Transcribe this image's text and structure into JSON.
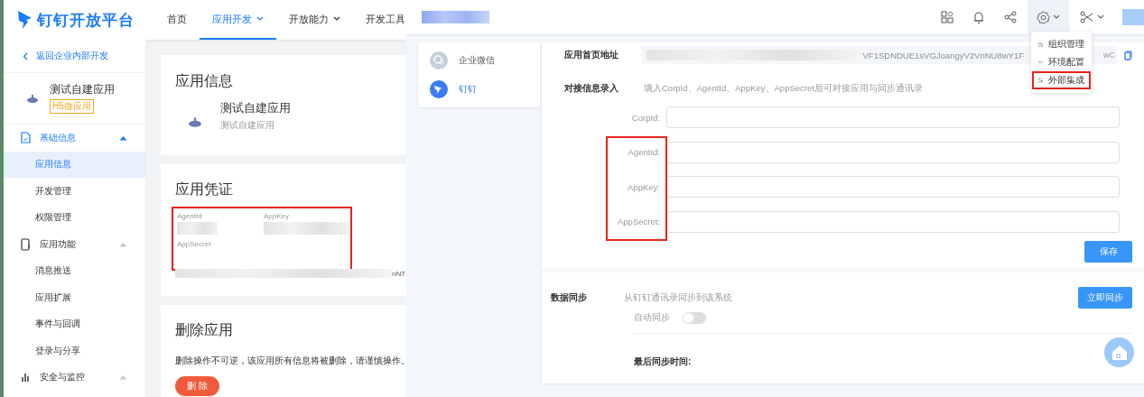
{
  "left_window": {
    "logo": "钉钉开放平台",
    "nav": [
      {
        "label": "首页",
        "selected": false,
        "dropdown": false
      },
      {
        "label": "应用开发",
        "selected": true,
        "dropdown": true
      },
      {
        "label": "开放能力",
        "selected": false,
        "dropdown": true
      },
      {
        "label": "开发工具",
        "selected": false,
        "dropdown": false
      }
    ],
    "sidebar": {
      "back_link": "返回企业内部开发",
      "app": {
        "name": "测试自建应用",
        "badge": "H5微应用"
      },
      "groups": [
        {
          "label": "基础信息",
          "kind": "document",
          "expanded": true,
          "active": true,
          "children": [
            {
              "label": "应用信息",
              "selected": true
            },
            {
              "label": "开发管理",
              "selected": false
            },
            {
              "label": "权限管理",
              "selected": false
            }
          ]
        },
        {
          "label": "应用功能",
          "kind": "phone",
          "expanded": true,
          "active": false,
          "children": [
            {
              "label": "消息推送",
              "selected": false
            },
            {
              "label": "应用扩展",
              "selected": false
            },
            {
              "label": "事件与回调",
              "selected": false
            },
            {
              "label": "登录与分享",
              "selected": false
            }
          ]
        },
        {
          "label": "安全与监控",
          "kind": "chart",
          "expanded": true,
          "active": false
        }
      ]
    },
    "app_info": {
      "title": "应用信息",
      "name": "测试自建应用",
      "description": "测试自建应用"
    },
    "credentials": {
      "title": "应用凭证",
      "highlighted": true,
      "fields": [
        {
          "label": "AgentId"
        },
        {
          "label": "AppKey"
        }
      ],
      "secret": {
        "label": "AppSecret",
        "visible_tail": "nNT"
      }
    },
    "delete": {
      "title": "删除应用",
      "warning": "删除操作不可逆，该应用所有信息将被删除，请谨慎操作。",
      "button": "删 除"
    }
  },
  "right_window": {
    "header_icons": [
      {
        "kind": "apps",
        "dropdown": false,
        "open": false
      },
      {
        "kind": "bell",
        "dropdown": false,
        "open": false
      },
      {
        "kind": "share",
        "dropdown": false,
        "open": false
      },
      {
        "kind": "gear",
        "dropdown": true,
        "open": true
      },
      {
        "kind": "tools",
        "dropdown": true,
        "open": false
      }
    ],
    "settings_menu": [
      {
        "label": "组织管理",
        "kind": "building",
        "highlighted": false
      },
      {
        "label": "环境配置",
        "kind": "env",
        "highlighted": false
      },
      {
        "label": "外部集成",
        "kind": "integration",
        "highlighted": true
      }
    ],
    "platforms": [
      {
        "label": "企业微信",
        "kind": "wecom",
        "selected": false
      },
      {
        "label": "钉钉",
        "kind": "dingtalk",
        "selected": true
      }
    ],
    "homepage": {
      "label": "应用首页地址",
      "visible_text": "VF1SDNDUE1sVGJoangyV2VnNU8wY1F",
      "visible_tail": "wC"
    },
    "integration": {
      "label": "对接信息录入",
      "hint": "填入CorpId、AgentId、AppKey、AppSecret后可对接应用与同步通讯录",
      "fields": [
        {
          "label": "CorpId:",
          "highlighted": false
        },
        {
          "label": "AgentId:",
          "highlighted": true
        },
        {
          "label": "AppKey:",
          "highlighted": true
        },
        {
          "label": "AppSecret:",
          "highlighted": true
        }
      ],
      "save_button": "保存"
    },
    "sync": {
      "label": "数据同步",
      "description": "从钉钉通讯录同步到该系统",
      "button": "立即同步",
      "auto_label": "自动同步",
      "auto_on": false,
      "last_label": "最后同步时间:"
    }
  }
}
